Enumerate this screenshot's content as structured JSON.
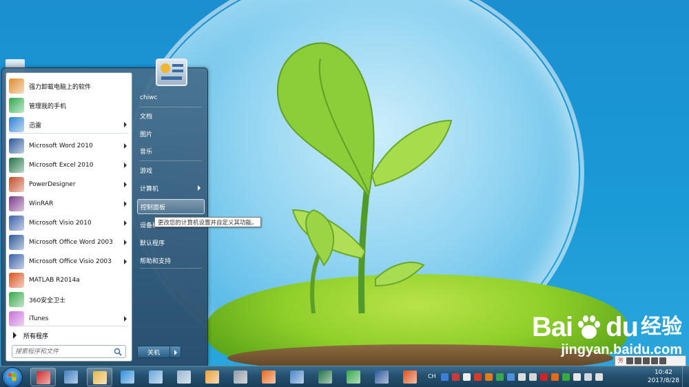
{
  "start_menu": {
    "left_items": [
      {
        "label": "强力卸载电脑上的软件",
        "icon": "uninstall-box-icon",
        "color": "#e08a2a",
        "arrow": false
      },
      {
        "label": "管理我的手机",
        "icon": "phone-manager-icon",
        "color": "#2eaa4e",
        "arrow": false
      },
      {
        "label": "迅雷",
        "icon": "thunder-bird-icon",
        "color": "#2a7fd4",
        "arrow": true
      },
      {
        "label": "Microsoft Word 2010",
        "icon": "word-icon",
        "color": "#2b579a",
        "arrow": true
      },
      {
        "label": "Microsoft Excel 2010",
        "icon": "excel-icon",
        "color": "#217346",
        "arrow": true
      },
      {
        "label": "PowerDesigner",
        "icon": "powerdesigner-icon",
        "color": "#c44a2a",
        "arrow": true
      },
      {
        "label": "WinRAR",
        "icon": "winrar-icon",
        "color": "#7a3a8a",
        "arrow": true
      },
      {
        "label": "Microsoft Visio 2010",
        "icon": "visio-icon",
        "color": "#3a5fa8",
        "arrow": true
      },
      {
        "label": "Microsoft Office Word 2003",
        "icon": "word-2003-icon",
        "color": "#2b579a",
        "arrow": true
      },
      {
        "label": "Microsoft Office Visio 2003",
        "icon": "visio-2003-icon",
        "color": "#3a5fa8",
        "arrow": true
      },
      {
        "label": "MATLAB R2014a",
        "icon": "matlab-icon",
        "color": "#d9531e",
        "arrow": false
      },
      {
        "label": "360安全卫士",
        "icon": "360-safe-icon",
        "color": "#34a84a",
        "arrow": false
      },
      {
        "label": "iTunes",
        "icon": "itunes-icon",
        "color": "#c86fd8",
        "arrow": true
      }
    ],
    "all_programs": "所有程序",
    "search_placeholder": "搜索程序和文件",
    "right_items": [
      {
        "label": "chiwc",
        "arrow": false,
        "highlighted": false
      },
      {
        "label": "文档",
        "arrow": false,
        "highlighted": false
      },
      {
        "label": "图片",
        "arrow": false,
        "highlighted": false
      },
      {
        "label": "音乐",
        "arrow": false,
        "highlighted": false
      },
      {
        "label": "游戏",
        "arrow": false,
        "highlighted": false
      },
      {
        "label": "计算机",
        "arrow": true,
        "highlighted": false
      },
      {
        "label": "控制面板",
        "arrow": false,
        "highlighted": true
      },
      {
        "label": "设备和",
        "arrow": false,
        "highlighted": false
      },
      {
        "label": "默认程序",
        "arrow": false,
        "highlighted": false
      },
      {
        "label": "帮助和支持",
        "arrow": false,
        "highlighted": false
      }
    ],
    "shutdown_label": "关机",
    "tooltip": "更改您的计算机设置并自定义其功能。"
  },
  "taskbar": {
    "pinned": [
      {
        "icon": "red-g-app-icon",
        "color": "#d12a2a",
        "active": true
      },
      {
        "icon": "remote-desktop-icon",
        "color": "#3f7fbf",
        "active": false
      },
      {
        "icon": "file-explorer-icon",
        "color": "#e7b84a",
        "active": true
      },
      {
        "icon": "internet-explorer-icon",
        "color": "#2f8fd8",
        "active": false
      },
      {
        "icon": "paint-icon",
        "color": "#6aa7d9",
        "active": false
      },
      {
        "icon": "document-viewer-icon",
        "color": "#9ab8d0",
        "active": false
      },
      {
        "icon": "search-tool-icon",
        "color": "#e9a23b",
        "active": false
      },
      {
        "icon": "calculator-icon",
        "color": "#8f9aa6",
        "active": false
      },
      {
        "icon": "firefox-icon",
        "color": "#e66a1e",
        "active": false
      },
      {
        "icon": "network-tool-icon",
        "color": "#4a86c8",
        "active": false
      },
      {
        "icon": "excel-icon",
        "color": "#217346",
        "active": false
      },
      {
        "icon": "360-safe-icon",
        "color": "#34a84a",
        "active": false
      },
      {
        "icon": "word-icon",
        "color": "#2b579a",
        "active": false
      },
      {
        "icon": "matlab-icon",
        "color": "#d9531e",
        "active": false
      }
    ],
    "tray": {
      "lang": "CH",
      "icons": [
        {
          "name": "help-icon",
          "color": "#3b7fd6"
        },
        {
          "name": "app-icon",
          "color": "#c43c3c"
        },
        {
          "name": "notes-icon",
          "color": "#eeeeee"
        },
        {
          "name": "red-app-icon",
          "color": "#d33b2c"
        },
        {
          "name": "orange-app-icon",
          "color": "#e07b22"
        },
        {
          "name": "green-app-icon",
          "color": "#3aa35a"
        },
        {
          "name": "shield-icon",
          "color": "#4f8fd8"
        },
        {
          "name": "network-icon",
          "color": "#dddddd"
        },
        {
          "name": "volume-icon",
          "color": "#d7d7d7"
        },
        {
          "name": "red-flag-icon",
          "color": "#c62828"
        },
        {
          "name": "firefox-tray-icon",
          "color": "#e06a1e"
        },
        {
          "name": "360-tray-icon",
          "color": "#3aa845"
        },
        {
          "name": "flag-icon",
          "color": "#e8e8e8"
        },
        {
          "name": "battery-icon",
          "color": "#cfd8dc"
        },
        {
          "name": "speaker-icon",
          "color": "#e0e0e0"
        }
      ],
      "time": "10:42",
      "date": "2017/8/28"
    },
    "ime_glyph": "芳"
  },
  "watermark": {
    "brand_left": "Bai",
    "brand_right": "du",
    "brand_cn": "经验",
    "url": "jingyan.baidu.com"
  }
}
